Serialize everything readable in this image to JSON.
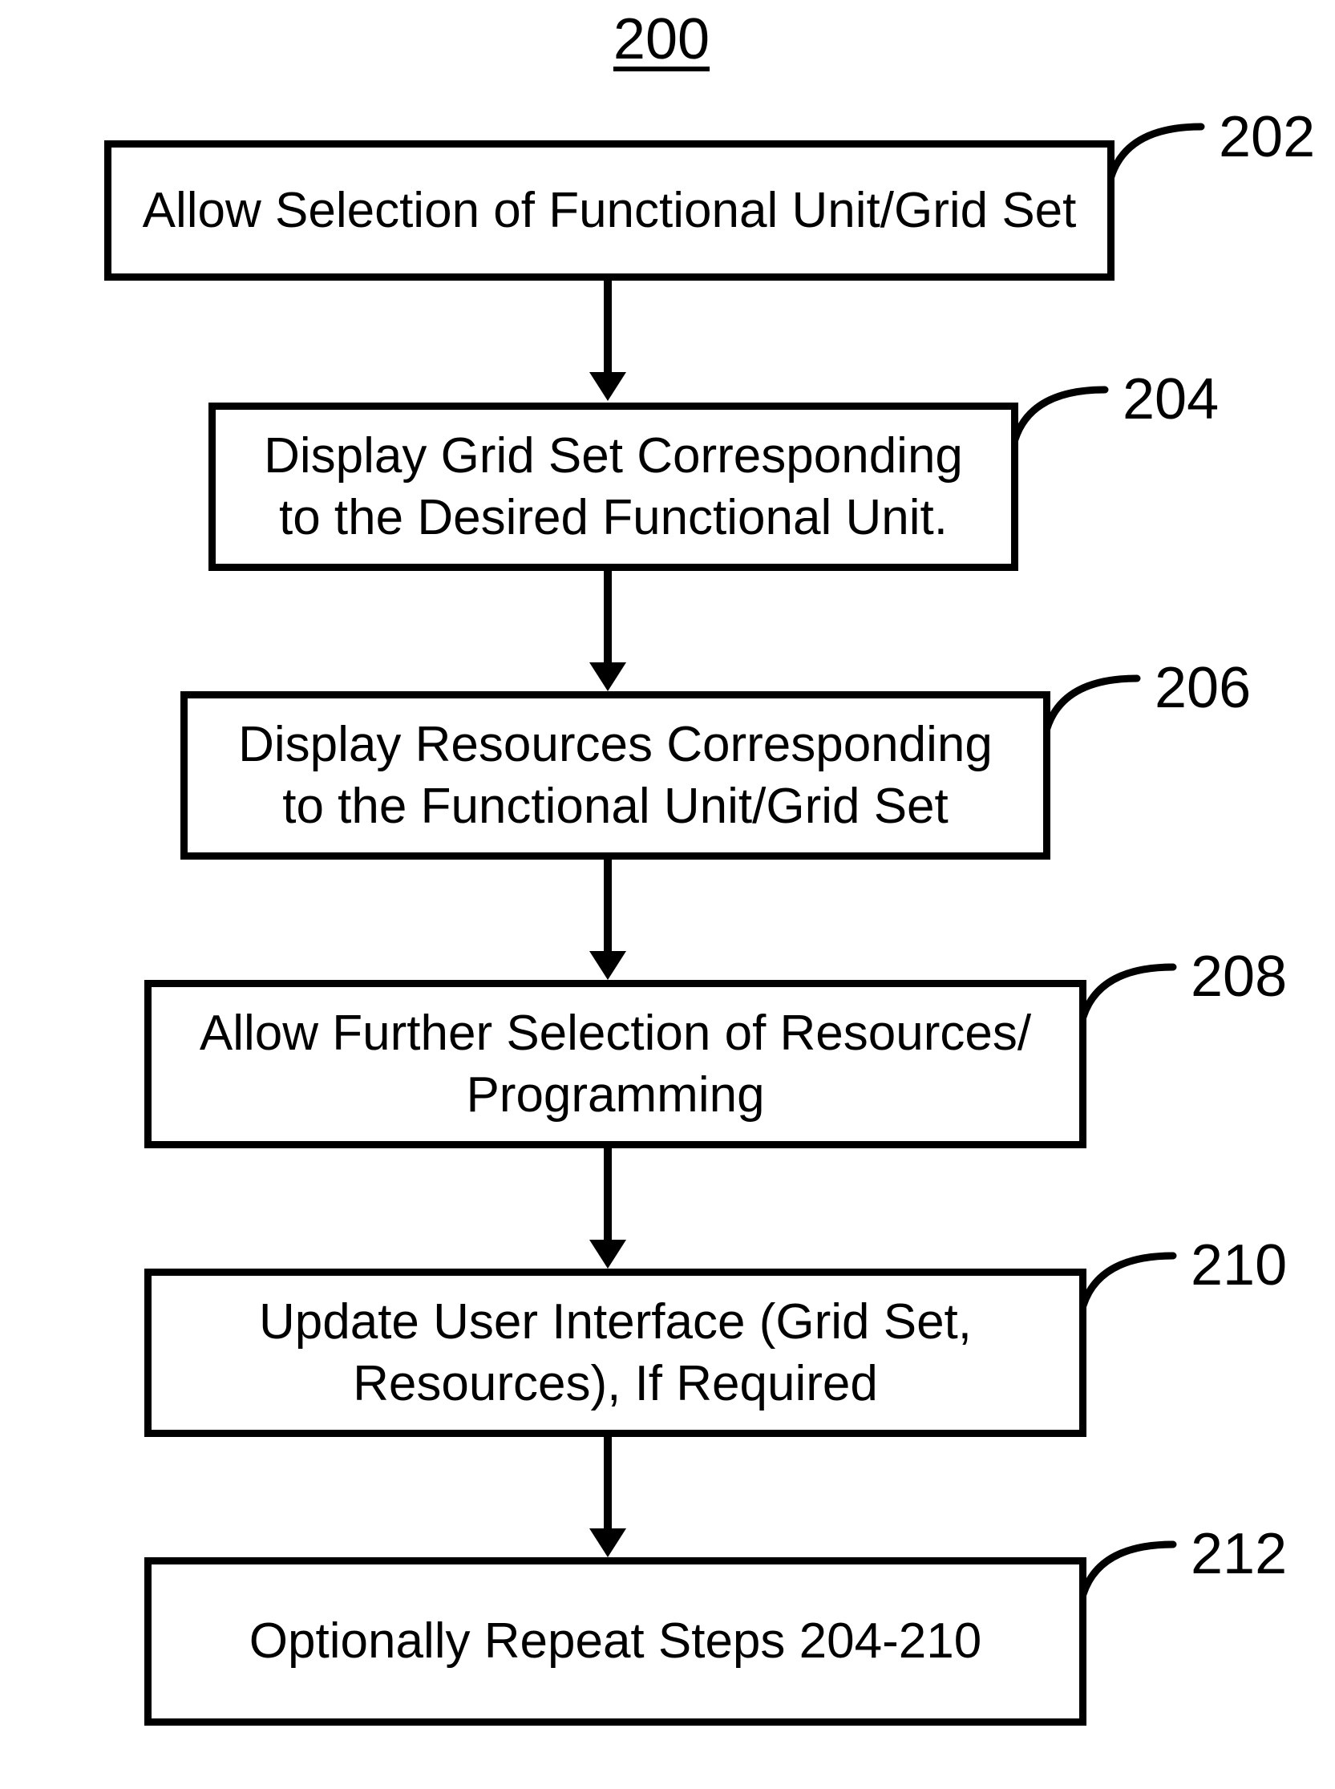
{
  "title": "200",
  "steps": [
    {
      "num": "202",
      "text": "Allow Selection of Functional Unit/Grid Set"
    },
    {
      "num": "204",
      "text": "Display Grid Set Corresponding to the Desired Functional Unit."
    },
    {
      "num": "206",
      "text": "Display Resources Corresponding to the Functional Unit/Grid Set"
    },
    {
      "num": "208",
      "text": "Allow Further Selection of Resources/ Programming"
    },
    {
      "num": "210",
      "text": "Update User Interface (Grid Set, Resources), If Required"
    },
    {
      "num": "212",
      "text": "Optionally Repeat Steps 204-210"
    }
  ]
}
